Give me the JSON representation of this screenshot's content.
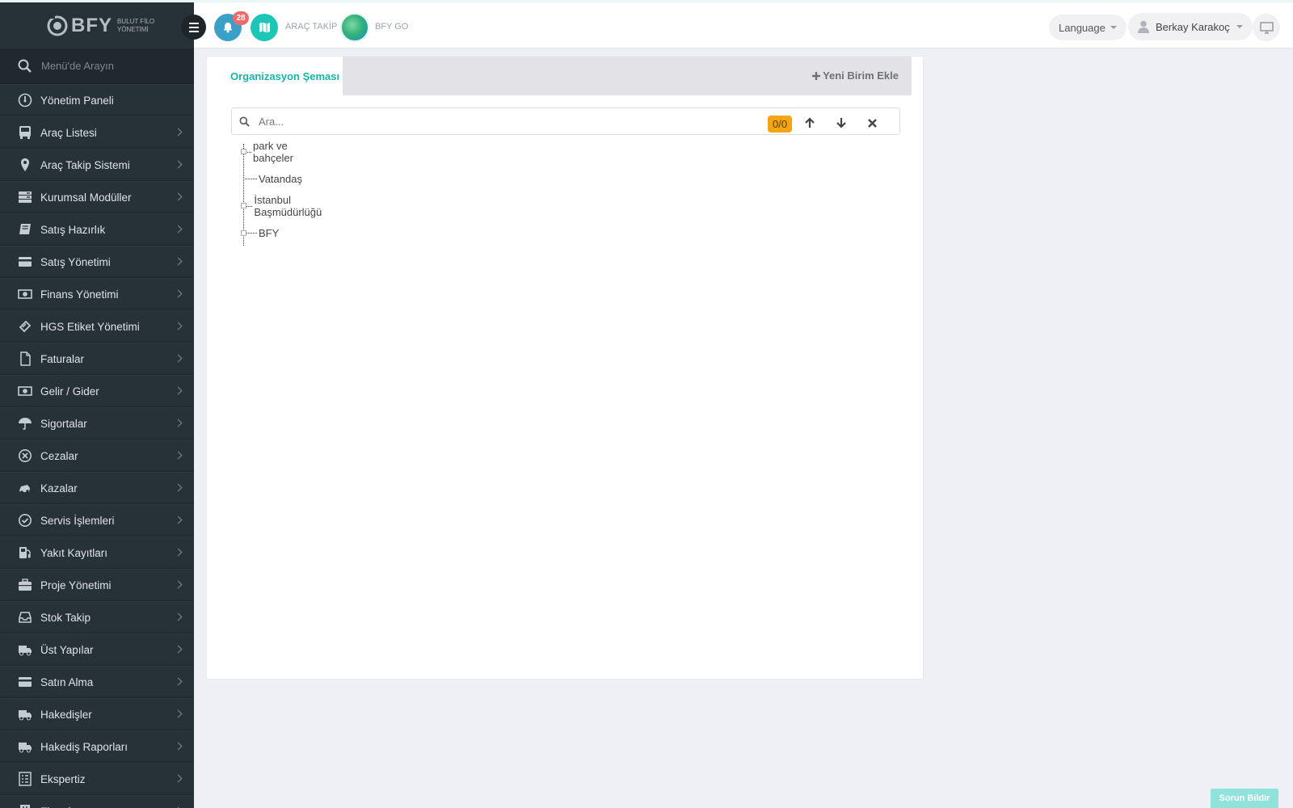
{
  "brand": {
    "name": "BFY",
    "subtitle_line1": "BULUT FİLO",
    "subtitle_line2": "YÖNETİMİ"
  },
  "header": {
    "notification_count": "28",
    "links": [
      {
        "label": "ARAÇ TAKİP",
        "icon": "map-icon"
      },
      {
        "label": "BFY GO",
        "icon": "bfy-go-logo-icon"
      }
    ],
    "language_label": "Language",
    "user_name": "Berkay Karakoç"
  },
  "sidebar": {
    "search_placeholder": "Menü'de Arayın",
    "items": [
      {
        "label": "Yönetim Paneli",
        "icon": "dashboard-icon",
        "has_submenu": false
      },
      {
        "label": "Araç Listesi",
        "icon": "bus-icon",
        "has_submenu": true
      },
      {
        "label": "Araç Takip Sistemi",
        "icon": "map-marker-icon",
        "has_submenu": true
      },
      {
        "label": "Kurumsal Modüller",
        "icon": "server-icon",
        "has_submenu": true
      },
      {
        "label": "Satış Hazırlık",
        "icon": "book-icon",
        "has_submenu": true
      },
      {
        "label": "Satış Yönetimi",
        "icon": "credit-card-icon",
        "has_submenu": true
      },
      {
        "label": "Finans Yönetimi",
        "icon": "money-icon",
        "has_submenu": true
      },
      {
        "label": "HGS Etiket Yönetimi",
        "icon": "ticket-icon",
        "has_submenu": true
      },
      {
        "label": "Faturalar",
        "icon": "file-icon",
        "has_submenu": true
      },
      {
        "label": "Gelir / Gider",
        "icon": "money-icon",
        "has_submenu": true
      },
      {
        "label": "Sigortalar",
        "icon": "umbrella-icon",
        "has_submenu": true
      },
      {
        "label": "Cezalar",
        "icon": "times-circle-icon",
        "has_submenu": true
      },
      {
        "label": "Kazalar",
        "icon": "car-crash-icon",
        "has_submenu": true
      },
      {
        "label": "Servis İşlemleri",
        "icon": "check-circle-icon",
        "has_submenu": true
      },
      {
        "label": "Yakıt Kayıtları",
        "icon": "gas-pump-icon",
        "has_submenu": true
      },
      {
        "label": "Proje Yönetimi",
        "icon": "briefcase-icon",
        "has_submenu": true
      },
      {
        "label": "Stok Takip",
        "icon": "inbox-icon",
        "has_submenu": true
      },
      {
        "label": "Üst Yapılar",
        "icon": "truck-icon",
        "has_submenu": true
      },
      {
        "label": "Satın Alma",
        "icon": "credit-card-icon",
        "has_submenu": true
      },
      {
        "label": "Hakedişler",
        "icon": "truck-icon",
        "has_submenu": true
      },
      {
        "label": "Hakediş Raporları",
        "icon": "truck-icon",
        "has_submenu": true
      },
      {
        "label": "Ekspertiz",
        "icon": "list-alt-icon",
        "has_submenu": true
      },
      {
        "label": "Firmalar",
        "icon": "building-icon",
        "has_submenu": true
      }
    ]
  },
  "main": {
    "tab_label": "Organizasyon Şeması",
    "add_unit_label": "Yeni Birim Ekle",
    "search_placeholder": "Ara...",
    "match_count": "0/0",
    "tree_nodes": [
      {
        "label": "park ve bahçeler",
        "expandable": true
      },
      {
        "label": "Vatandaş",
        "expandable": false
      },
      {
        "label": "İstanbul Başmüdürlüğü",
        "expandable": true
      },
      {
        "label": "BFY",
        "expandable": true
      }
    ]
  },
  "report_button_label": "Sorun Bildir",
  "colors": {
    "accent": "#1ab3a6",
    "sidebar_bg": "#263238",
    "badge": "#ef6b6b",
    "match_badge": "#f3a612"
  }
}
